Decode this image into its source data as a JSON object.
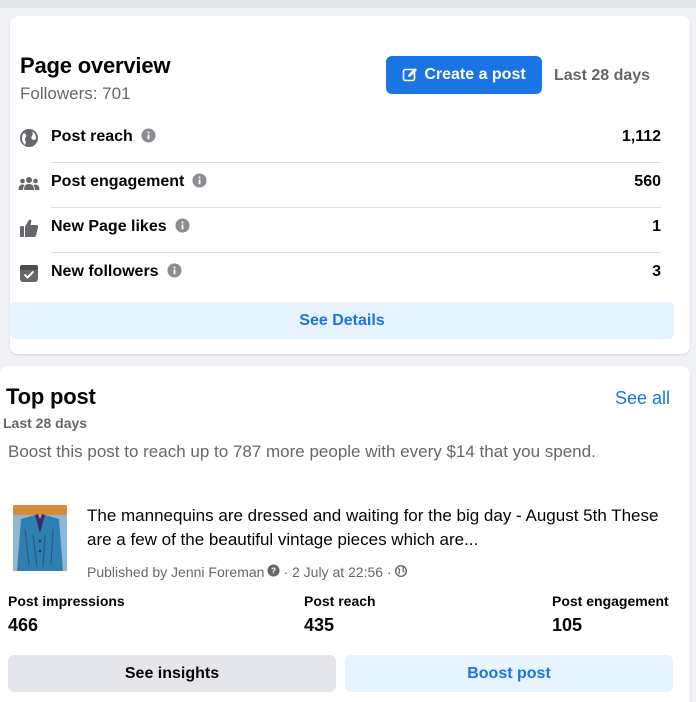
{
  "overview": {
    "title": "Page overview",
    "followers": "Followers: 701",
    "create_post_label": "Create a post",
    "period": "Last 28 days",
    "metrics": [
      {
        "label": "Post reach",
        "value": "1,112",
        "icon": "globe-icon"
      },
      {
        "label": "Post engagement",
        "value": "560",
        "icon": "people-icon"
      },
      {
        "label": "New Page likes",
        "value": "1",
        "icon": "thumbs-up-icon"
      },
      {
        "label": "New followers",
        "value": "3",
        "icon": "follow-icon"
      }
    ],
    "see_details_label": "See Details"
  },
  "top_post": {
    "title": "Top post",
    "period": "Last 28 days",
    "see_all_label": "See all",
    "boost_message": "Boost this post to reach up to 787 more people with every $14 that you spend.",
    "post_text": "The mannequins are dressed and waiting for the big day - August 5th These are a few of the beautiful vintage pieces which are...",
    "published_by": "Published by Jenni Foreman",
    "date": "· 2 July at 22:56 ·",
    "stats": [
      {
        "label": "Post impressions",
        "value": "466"
      },
      {
        "label": "Post reach",
        "value": "435"
      },
      {
        "label": "Post engagement",
        "value": "105"
      }
    ],
    "see_insights_label": "See insights",
    "boost_post_label": "Boost post"
  },
  "colors": {
    "accent": "#1b74e4",
    "accent_light": "#e7f3ff",
    "secondary_text": "#65676b",
    "page_bg": "#f0f2f5"
  }
}
